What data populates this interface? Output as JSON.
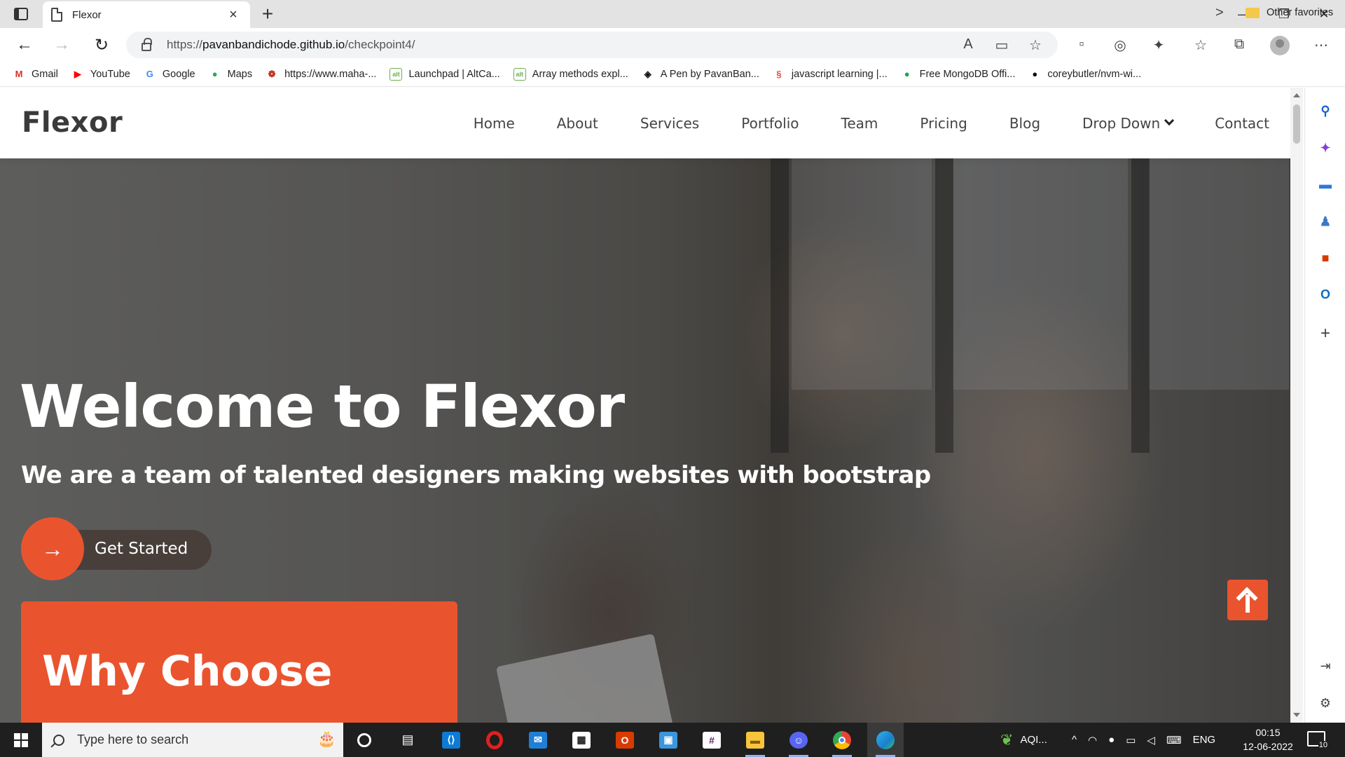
{
  "browser": {
    "tab_title": "Flexor",
    "tab_close": "×",
    "new_tab": "+",
    "url_prefix": "https://",
    "url_host": "pavanbandichode.github.io",
    "url_path": "/checkpoint4/",
    "window_controls": {
      "minimize": "—",
      "restore": "❐",
      "close": "✕"
    }
  },
  "bookmarks": [
    {
      "label": "Gmail",
      "icon": "gmail-icon",
      "glyph": "M",
      "color": "#d93025"
    },
    {
      "label": "YouTube",
      "icon": "youtube-icon",
      "glyph": "▶",
      "color": "#ff0000"
    },
    {
      "label": "Google",
      "icon": "google-icon",
      "glyph": "G",
      "color": "#4285f4"
    },
    {
      "label": "Maps",
      "icon": "maps-icon",
      "glyph": "●",
      "color": "#34a853"
    },
    {
      "label": "https://www.maha-...",
      "icon": "maha-icon",
      "glyph": "❁",
      "color": "#c0392b"
    },
    {
      "label": "Launchpad | AltCa...",
      "icon": "altcampus-icon",
      "glyph": "alt",
      "color": "#6ab04c"
    },
    {
      "label": "Array methods expl...",
      "icon": "altcampus-icon",
      "glyph": "alt",
      "color": "#6ab04c"
    },
    {
      "label": "A Pen by PavanBan...",
      "icon": "codepen-icon",
      "glyph": "◈",
      "color": "#111111"
    },
    {
      "label": "javascript learning |...",
      "icon": "learning-icon",
      "glyph": "§",
      "color": "#e74c3c"
    },
    {
      "label": "Free MongoDB Offi...",
      "icon": "mongodb-icon",
      "glyph": "●",
      "color": "#13aa52"
    },
    {
      "label": "coreybutler/nvm-wi...",
      "icon": "github-icon",
      "glyph": "●",
      "color": "#111111"
    }
  ],
  "bookmarks_more": ">",
  "other_favorites": "Other favorites",
  "site": {
    "logo": "Flexor",
    "nav": [
      {
        "label": "Home"
      },
      {
        "label": "About"
      },
      {
        "label": "Services"
      },
      {
        "label": "Portfolio"
      },
      {
        "label": "Team"
      },
      {
        "label": "Pricing"
      },
      {
        "label": "Blog"
      },
      {
        "label": "Drop Down",
        "dropdown": true
      },
      {
        "label": "Contact"
      }
    ],
    "hero": {
      "title": "Welcome to Flexor",
      "subtitle": "We are a team of talented designers making websites with bootstrap",
      "cta_label": "Get Started",
      "cta_icon": "→"
    },
    "why_card_title": "Why Choose",
    "accent_color": "#e9542f"
  },
  "taskbar": {
    "search_placeholder": "Type here to search",
    "weather_label": "AQI...",
    "language": "ENG",
    "time": "00:15",
    "date": "12-06-2022",
    "notifications": "10",
    "apps": [
      "cortana-icon",
      "task-view-icon",
      "vscode-icon",
      "opera-icon",
      "mail-icon",
      "store-icon",
      "office-icon",
      "remote-desktop-icon",
      "slack-icon",
      "file-explorer-icon",
      "discord-icon",
      "chrome-icon",
      "edge-icon"
    ]
  }
}
